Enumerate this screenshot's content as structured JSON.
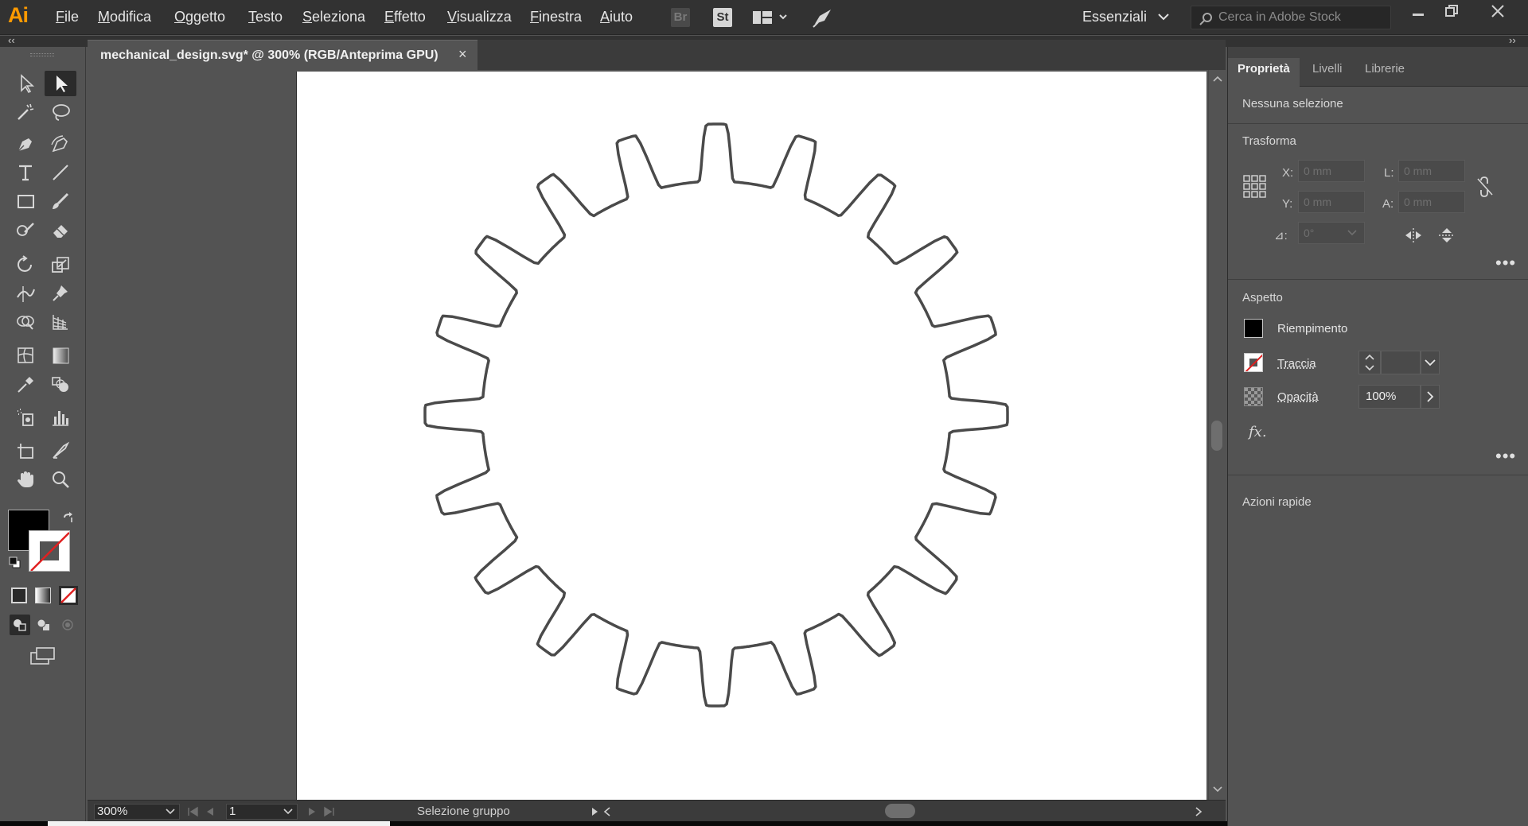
{
  "app": {
    "logo": "Ai",
    "menu": [
      "File",
      "Modifica",
      "Oggetto",
      "Testo",
      "Seleziona",
      "Effetto",
      "Visualizza",
      "Finestra",
      "Aiuto"
    ],
    "bridge_label": "Br",
    "stock_label": "St",
    "workspace": "Essenziali",
    "stock_search_placeholder": "Cerca in Adobe Stock",
    "collapse_left": "‹‹",
    "collapse_right": "››"
  },
  "document": {
    "tab_title": "mechanical_design.svg* @ 300% (RGB/Anteprima GPU)",
    "close": "×"
  },
  "canvas": {
    "gear_teeth": 20,
    "stroke_color": "#4a4a4a",
    "artboard_color": "#ffffff"
  },
  "status": {
    "zoom": "300%",
    "page": "1",
    "text": "Selezione gruppo"
  },
  "panel": {
    "tabs": [
      "Proprietà",
      "Livelli",
      "Librerie"
    ],
    "no_selection": "Nessuna selezione",
    "transform": {
      "title": "Trasforma",
      "x_label": "X:",
      "x_value": "0 mm",
      "y_label": "Y:",
      "y_value": "0 mm",
      "w_label": "L:",
      "w_value": "0 mm",
      "h_label": "A:",
      "h_value": "0 mm",
      "angle_label": "⊿:",
      "angle_value": "0°"
    },
    "appearance": {
      "title": "Aspetto",
      "fill_label": "Riempimento",
      "stroke_label": "Traccia",
      "opacity_label": "Opacità",
      "opacity_value": "100%",
      "fx_label": "fx."
    },
    "quick_actions": "Azioni rapide",
    "more": "•••"
  },
  "colors": {
    "accent_orange": "#ff9a00",
    "fill_swatch": "#000000",
    "stroke_none": "#e02020"
  }
}
